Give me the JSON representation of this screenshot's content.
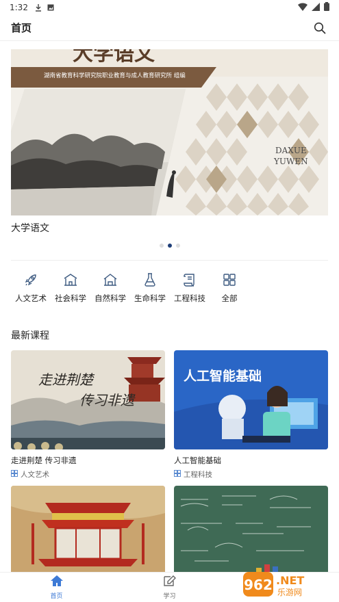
{
  "status_bar": {
    "time": "1:32"
  },
  "app_bar": {
    "title": "首页",
    "search_icon": "search-icon"
  },
  "banner": {
    "book_publisher": "湖南省教育科学研究院职业教育与成人教育研究所 组编",
    "book_title_line1": "DAXUE",
    "book_title_line2": "YUWEN",
    "caption": "大学语文",
    "dots": [
      false,
      true,
      false
    ]
  },
  "categories": [
    {
      "label": "人文艺术",
      "icon": "rocket-icon"
    },
    {
      "label": "社会科学",
      "icon": "building-icon"
    },
    {
      "label": "自然科学",
      "icon": "house-icon"
    },
    {
      "label": "生命科学",
      "icon": "flask-icon"
    },
    {
      "label": "工程科技",
      "icon": "scroll-icon"
    },
    {
      "label": "全部",
      "icon": "grid-icon"
    }
  ],
  "latest": {
    "title": "最新课程",
    "courses": [
      {
        "title": "走进荆楚 传习非遗",
        "tag": "人文艺术",
        "thumb_text1": "走进荆楚",
        "thumb_text2": "传习非遗"
      },
      {
        "title": "人工智能基础",
        "tag": "工程科技",
        "thumb_text1": "人工智能基础"
      },
      {
        "title": "",
        "tag": ""
      },
      {
        "title": "",
        "tag": ""
      }
    ]
  },
  "tabs": [
    {
      "label": "首页",
      "icon": "home-icon",
      "active": true
    },
    {
      "label": "学习",
      "icon": "edit-icon",
      "active": false
    }
  ],
  "watermark": {
    "text": "962.NET",
    "sub": "乐游网"
  },
  "colors": {
    "accent": "#3d7ad6",
    "dot_active": "#1f3f78"
  }
}
